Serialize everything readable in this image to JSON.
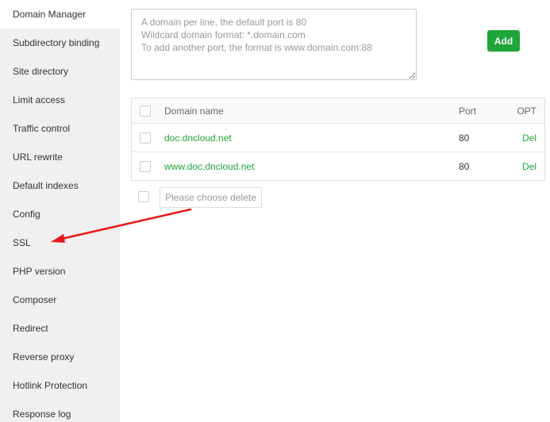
{
  "sidebar": {
    "items": [
      {
        "label": "Domain Manager",
        "active": true
      },
      {
        "label": "Subdirectory binding"
      },
      {
        "label": "Site directory"
      },
      {
        "label": "Limit access"
      },
      {
        "label": "Traffic control"
      },
      {
        "label": "URL rewrite"
      },
      {
        "label": "Default indexes"
      },
      {
        "label": "Config"
      },
      {
        "label": "SSL"
      },
      {
        "label": "PHP version"
      },
      {
        "label": "Composer"
      },
      {
        "label": "Redirect"
      },
      {
        "label": "Reverse proxy"
      },
      {
        "label": "Hotlink Protection"
      },
      {
        "label": "Response log"
      }
    ]
  },
  "domain_form": {
    "placeholder": "A domain per line, the default port is 80\nWildcard domain format: *.domain.com\nTo add another port, the format is www.domain.com:88",
    "value": "",
    "add_label": "Add"
  },
  "table": {
    "headers": {
      "name": "Domain name",
      "port": "Port",
      "opt": "OPT"
    },
    "rows": [
      {
        "name": "doc.dncloud.net",
        "port": "80",
        "opt": "Del"
      },
      {
        "name": "www.doc.dncloud.net",
        "port": "80",
        "opt": "Del"
      }
    ]
  },
  "batch": {
    "delete_label": "Please choose delete"
  },
  "colors": {
    "accent": "#20a53a",
    "annotation_arrow": "#e8191a",
    "sidebar_bg": "#f0f0f0"
  }
}
